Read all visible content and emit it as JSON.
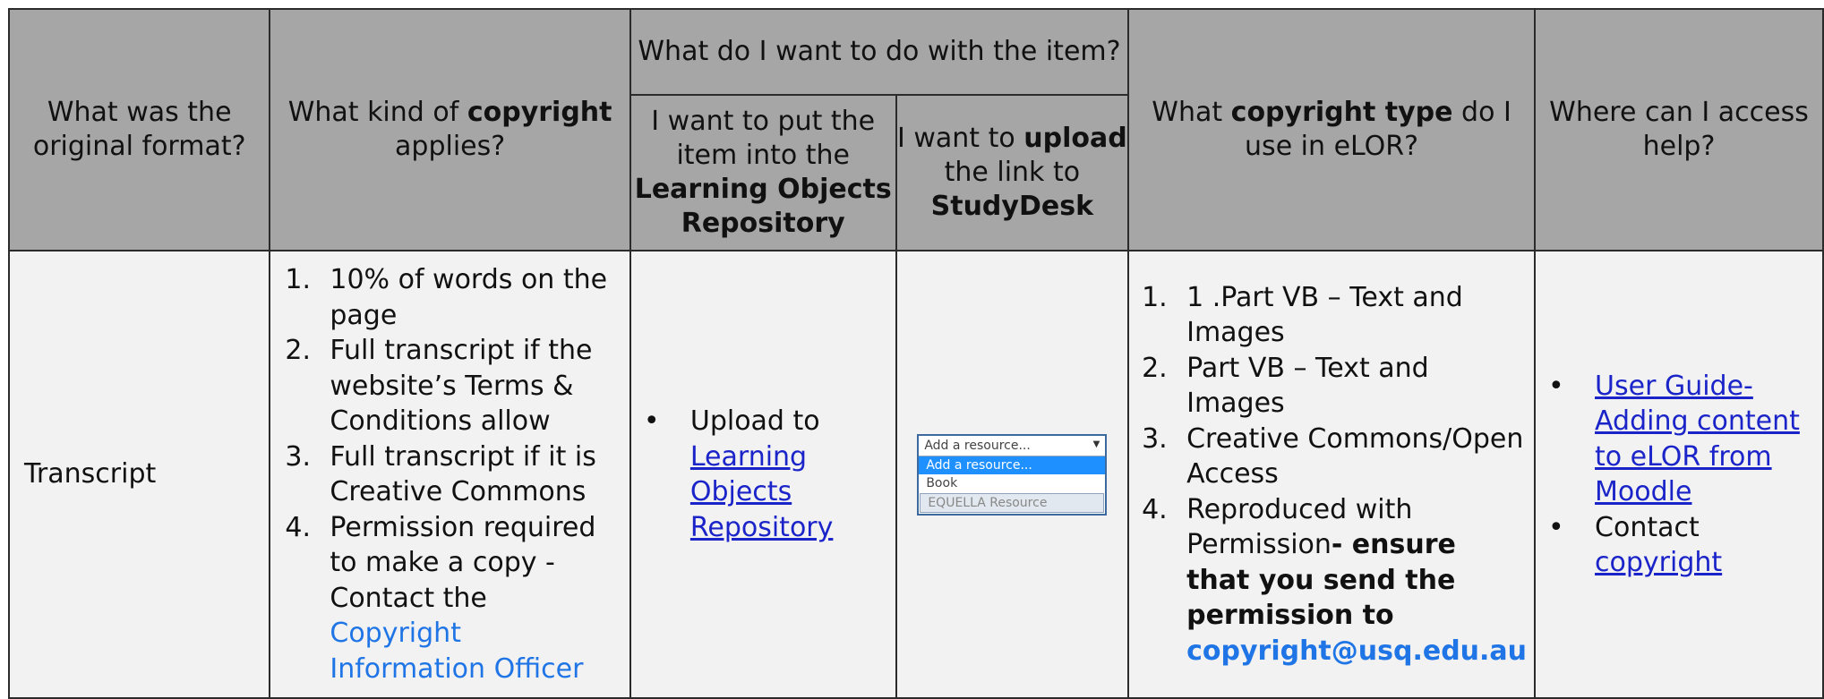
{
  "header": {
    "col1": "What was the original format?",
    "col2_pre": "What kind of ",
    "col2_bold": "copyright",
    "col2_post": " applies?",
    "group": "What do I want to do with the item?",
    "sub1_pre": "I want to put the item into the ",
    "sub1_bold": "Learning Objects Repository",
    "sub2_pre": "I want to ",
    "sub2_bold1": "upload",
    "sub2_mid": " the link to ",
    "sub2_bold2": "StudyDesk",
    "col5_pre": "What ",
    "col5_bold": "copyright type",
    "col5_post": " do I use in eLOR?",
    "col6": "Where can I access help?"
  },
  "row": {
    "format": "Transcript",
    "copyright": {
      "item1": "10% of words on the page",
      "item2": "Full transcript if the website’s Terms & Conditions allow",
      "item3": " Full transcript if it is Creative Commons",
      "item4_text": "Permission required to make a copy - Contact the ",
      "item4_link": "Copyright Information Officer"
    },
    "repository": {
      "text": "Upload to ",
      "link": "Learning Objects Repository"
    },
    "dropdown": {
      "selected": "Add a resource...",
      "options": [
        "Add a resource...",
        "Book",
        "EQUELLA Resource"
      ]
    },
    "types": {
      "item1": "1 .Part VB – Text and Images",
      "item2": "Part VB – Text and Images",
      "item3": "Creative Commons/Open Access",
      "item4_text": "Reproduced with Permission",
      "item4_bold": "- ensure that you send the permission to ",
      "item4_email": "copyright@usq.edu.au"
    },
    "help": {
      "item1_link": "User Guide- Adding content to eLOR from Moodle",
      "item2_text": "Contact ",
      "item2_link": "copyright"
    }
  },
  "list_numbers": [
    "1.",
    "2.",
    "3.",
    "4."
  ],
  "bullet": "•"
}
